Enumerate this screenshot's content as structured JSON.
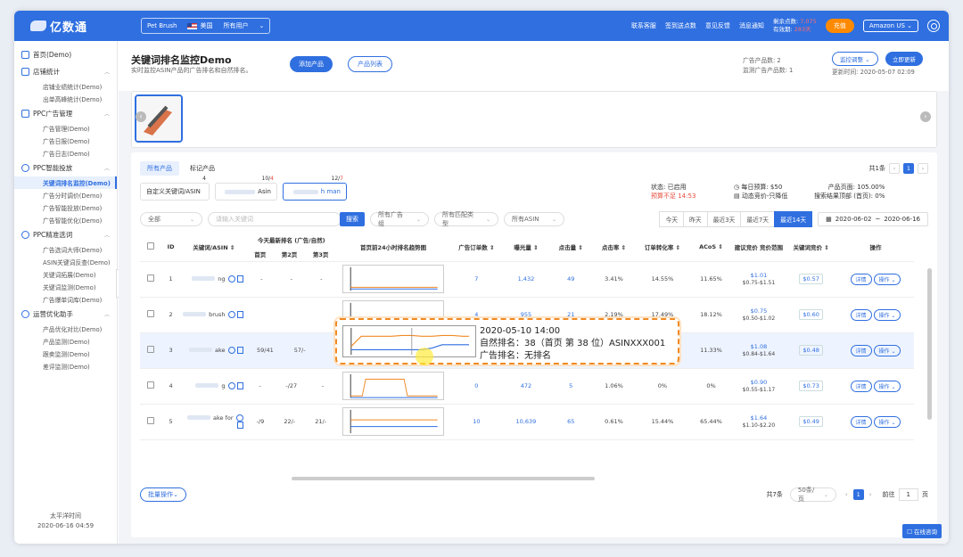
{
  "topbar": {
    "logo": "亿数通",
    "store_name": "Pet Brush",
    "country": "美国",
    "user": "所有用户",
    "links": [
      "联系客服",
      "签到送点数",
      "意见反馈",
      "消息通知"
    ],
    "balance_label": "剩余点数: ",
    "balance_value": "7,075",
    "expiry_label": "有效期: ",
    "expiry_value": "283天",
    "recharge": "充值",
    "marketplace": "Amazon US"
  },
  "sidebar": {
    "home": "首页(Demo)",
    "groups": [
      {
        "label": "店铺统计",
        "items": [
          "店铺业绩统计(Demo)",
          "出单高峰统计(Demo)"
        ]
      },
      {
        "label": "PPC广告管理",
        "items": [
          "广告管理(Demo)",
          "广告日报(Demo)",
          "广告日志(Demo)"
        ]
      },
      {
        "label": "PPC智能投放",
        "items": [
          "关键词排名监控(Demo)",
          "广告分时调价(Demo)",
          "广告智能投放(Demo)",
          "广告智能优化(Demo)"
        ]
      },
      {
        "label": "PPC精准选词",
        "items": [
          "广告选词大师(Demo)",
          "ASIN关键词反查(Demo)",
          "关键词拓展(Demo)",
          "关键词监测(Demo)",
          "广告爆单词库(Demo)"
        ]
      },
      {
        "label": "运营优化助手",
        "items": [
          "产品优化对比(Demo)",
          "产品监测(Demo)",
          "跟卖监测(Demo)",
          "差评监测(Demo)"
        ]
      }
    ],
    "footer_tz": "太平洋时间",
    "footer_time": "2020-06-16 04:59"
  },
  "header": {
    "title": "关键词排名监控Demo",
    "subtitle": "实时监控ASIN产品的广告排名和自然排名。",
    "add_product": "添加产品",
    "product_list": "产品列表",
    "ad_products": "广告产品数: 2",
    "monitored": "监测广告产品数: 1",
    "monitor_adjust": "监控调整",
    "refresh": "立即更新",
    "updated": "更新时间: 2020-05-07 02:09"
  },
  "panel": {
    "tabs": [
      "所有产品",
      "标记产品"
    ],
    "total": "共1条",
    "page": "1",
    "kw_tabs": [
      {
        "label": "自定义关键词/ASIN",
        "count_a": "4",
        "count_b": ""
      },
      {
        "label": "Asin",
        "count_a": "10",
        "count_b": "4"
      },
      {
        "label": "h man",
        "count_a": "12",
        "count_b": "7"
      }
    ],
    "status_label": "状态: 已启用",
    "budget_warn": "预算不足 14:53",
    "daily_budget": "每日预算: $50",
    "dynamic": "动态竞价-只降低",
    "product_page": "产品页面: 105.00%",
    "search_top": "搜索结果顶部 (首页): 0%"
  },
  "filters": {
    "all": "全部",
    "kw_placeholder": "请输入关键词",
    "search": "搜索",
    "ad_group": "所有广告组",
    "match_type": "所有匹配类型",
    "asin": "所有ASIN",
    "dates": [
      "今天",
      "昨天",
      "最近3天",
      "最近7天",
      "最近14天"
    ],
    "range_start": "2020-06-02",
    "range_sep": "~",
    "range_end": "2020-06-16"
  },
  "table": {
    "headers": [
      "ID",
      "关键词/ASIN",
      "今天最新排名 (广告/自然)",
      "首页",
      "第2页",
      "第3页",
      "首页前24小时排名趋势图",
      "广告订单数",
      "曝光量",
      "点击量",
      "点击率",
      "订单转化率",
      "ACoS",
      "建议竞价 竞价范围",
      "关键词竞价",
      "操作"
    ],
    "rows": [
      {
        "id": "1",
        "kw": "ng",
        "p1": "-",
        "p2": "-",
        "p3": "-",
        "orders": "7",
        "imp": "1,432",
        "clicks": "49",
        "ctr": "3.41%",
        "cvr": "14.55%",
        "acos": "11.65%",
        "sug": "$1.01",
        "range": "$0.75-$1.51",
        "bid": "$0.57"
      },
      {
        "id": "2",
        "kw": "brush",
        "p1": "",
        "p2": "",
        "p3": "",
        "orders": "4",
        "imp": "955",
        "clicks": "21",
        "ctr": "2.19%",
        "cvr": "17.49%",
        "acos": "18.12%",
        "sug": "$0.75",
        "range": "$0.50-$1.02",
        "bid": "$0.60"
      },
      {
        "id": "3",
        "kw": "ake",
        "p1": "59/41",
        "p2": "57/-",
        "p3": "",
        "orders": "",
        "imp": "",
        "clicks": "",
        "ctr": "",
        "cvr": "",
        "acos": "11.33%",
        "sug": "$1.08",
        "range": "$0.84-$1.64",
        "bid": "$0.48"
      },
      {
        "id": "4",
        "kw": "g",
        "p1": "-",
        "p2": "-/27",
        "p3": "-",
        "orders": "0",
        "imp": "472",
        "clicks": "5",
        "ctr": "1.06%",
        "cvr": "0%",
        "acos": "0%",
        "sug": "$0.90",
        "range": "$0.55-$1.17",
        "bid": "$0.73"
      },
      {
        "id": "5",
        "kw": "ake for",
        "p1": "-/9",
        "p2": "22/-",
        "p3": "21/-",
        "orders": "10",
        "imp": "10,639",
        "clicks": "65",
        "ctr": "0.61%",
        "cvr": "15.44%",
        "acos": "65.44%",
        "sug": "$1.64",
        "range": "$1.10-$2.20",
        "bid": "$0.49"
      }
    ],
    "detail": "详情",
    "op": "操作"
  },
  "tooltip": {
    "time": "2020-05-10 14:00",
    "natural": "自然排名：38（首页 第 38 位）ASINXXX001",
    "ad": "广告排名：无排名"
  },
  "bottom": {
    "batch": "批量操作",
    "total": "共7条",
    "per_page": "50条/页",
    "page": "1",
    "goto": "前往",
    "goto_val": "1",
    "page_unit": "页"
  },
  "float": "在线咨询",
  "colors": {
    "primary": "#2f6fe0",
    "orange": "#ff8a00",
    "red": "#e64b3c"
  }
}
